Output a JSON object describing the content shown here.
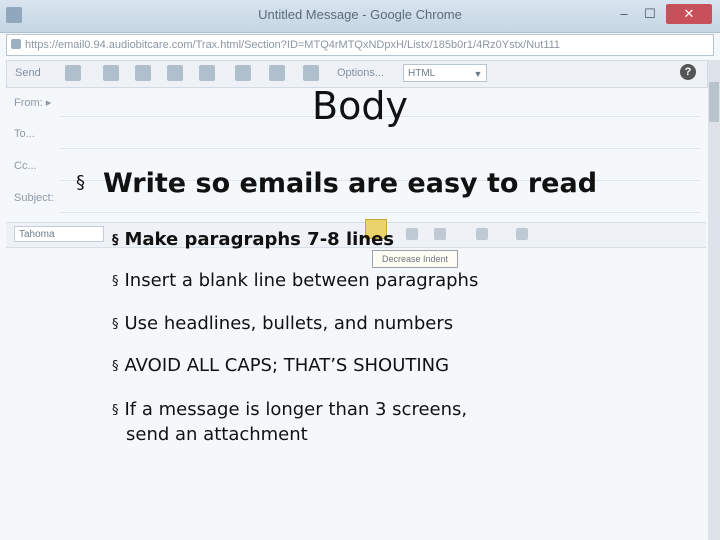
{
  "window": {
    "title": "Untitled Message - Google Chrome",
    "minimize": "–",
    "maximize": "☐",
    "close": "✕"
  },
  "address": {
    "url": "https://email0.94.audiobitcare.com/Trax.html/Section?ID=MTQ4rMTQxNDpxH/Listx/185b0r1/4Rz0Ystx/Nut111"
  },
  "toolbar": {
    "send": "Send",
    "options": "Options...",
    "format": "HTML"
  },
  "fields": {
    "from": "From: ▸",
    "to": "To...",
    "cc": "Cc...",
    "subject": "Subject:"
  },
  "format_bar": {
    "font": "Tahoma",
    "tooltip": "Decrease Indent"
  },
  "slide": {
    "title": "Body",
    "bullet_marker": "§",
    "main_bullet": "Write so emails are easy to read",
    "sub_bullets": [
      "Make paragraphs 7-8 lines",
      "Insert a blank line between paragraphs",
      "Use headlines, bullets, and numbers",
      "AVOID ALL CAPS; THAT’S SHOUTING"
    ],
    "last_bullet_line1": "If a message is longer than 3 screens,",
    "last_bullet_line2": "send an attachment"
  }
}
